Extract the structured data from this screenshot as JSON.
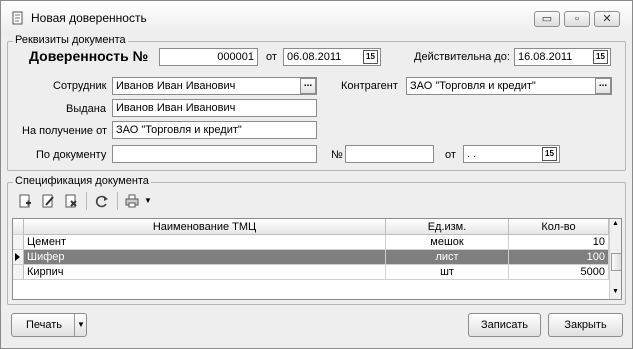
{
  "window": {
    "title": "Новая доверенность",
    "minimize_glyph": "▭",
    "maximize_glyph": "▫",
    "close_glyph": "✕"
  },
  "requisites": {
    "group_title": "Реквизиты документа",
    "doc_label": "Доверенность №",
    "doc_number": "000001",
    "from_label": "от",
    "doc_date": "06.08.2011",
    "valid_label": "Действительна до:",
    "valid_date": "16.08.2011",
    "employee_label": "Сотрудник",
    "employee_value": "Иванов Иван Иванович",
    "counterparty_label": "Контрагент",
    "counterparty_value": "ЗАО \"Торговля и кредит\"",
    "issued_label": "Выдана",
    "issued_value": "Иванов Иван Иванович",
    "receive_from_label": "На получение от",
    "receive_from_value": "ЗАО \"Торговля и кредит\"",
    "by_document_label": "По документу",
    "by_document_value": "",
    "number_label": "№",
    "number_value": "",
    "from_label2": "от",
    "from_date_value": ". .",
    "dots": "...",
    "calendar_glyph": "15"
  },
  "spec": {
    "group_title": "Спецификация документа",
    "columns": [
      "Наименование ТМЦ",
      "Ед.изм.",
      "Кол-во"
    ],
    "rows": [
      {
        "name": "Цемент",
        "unit": "мешок",
        "qty": "10"
      },
      {
        "name": "Шифер",
        "unit": "лист",
        "qty": "100"
      },
      {
        "name": "Кирпич",
        "unit": "шт",
        "qty": "5000"
      }
    ],
    "selected_row": 1,
    "scroll_up": "▲",
    "scroll_down": "▼"
  },
  "footer": {
    "print_label": "Печать",
    "print_arrow": "▼",
    "save_label": "Записать",
    "close_label": "Закрыть"
  },
  "colors": {
    "selection": "#7f7f7f",
    "window_bg": "#eeeeee"
  }
}
